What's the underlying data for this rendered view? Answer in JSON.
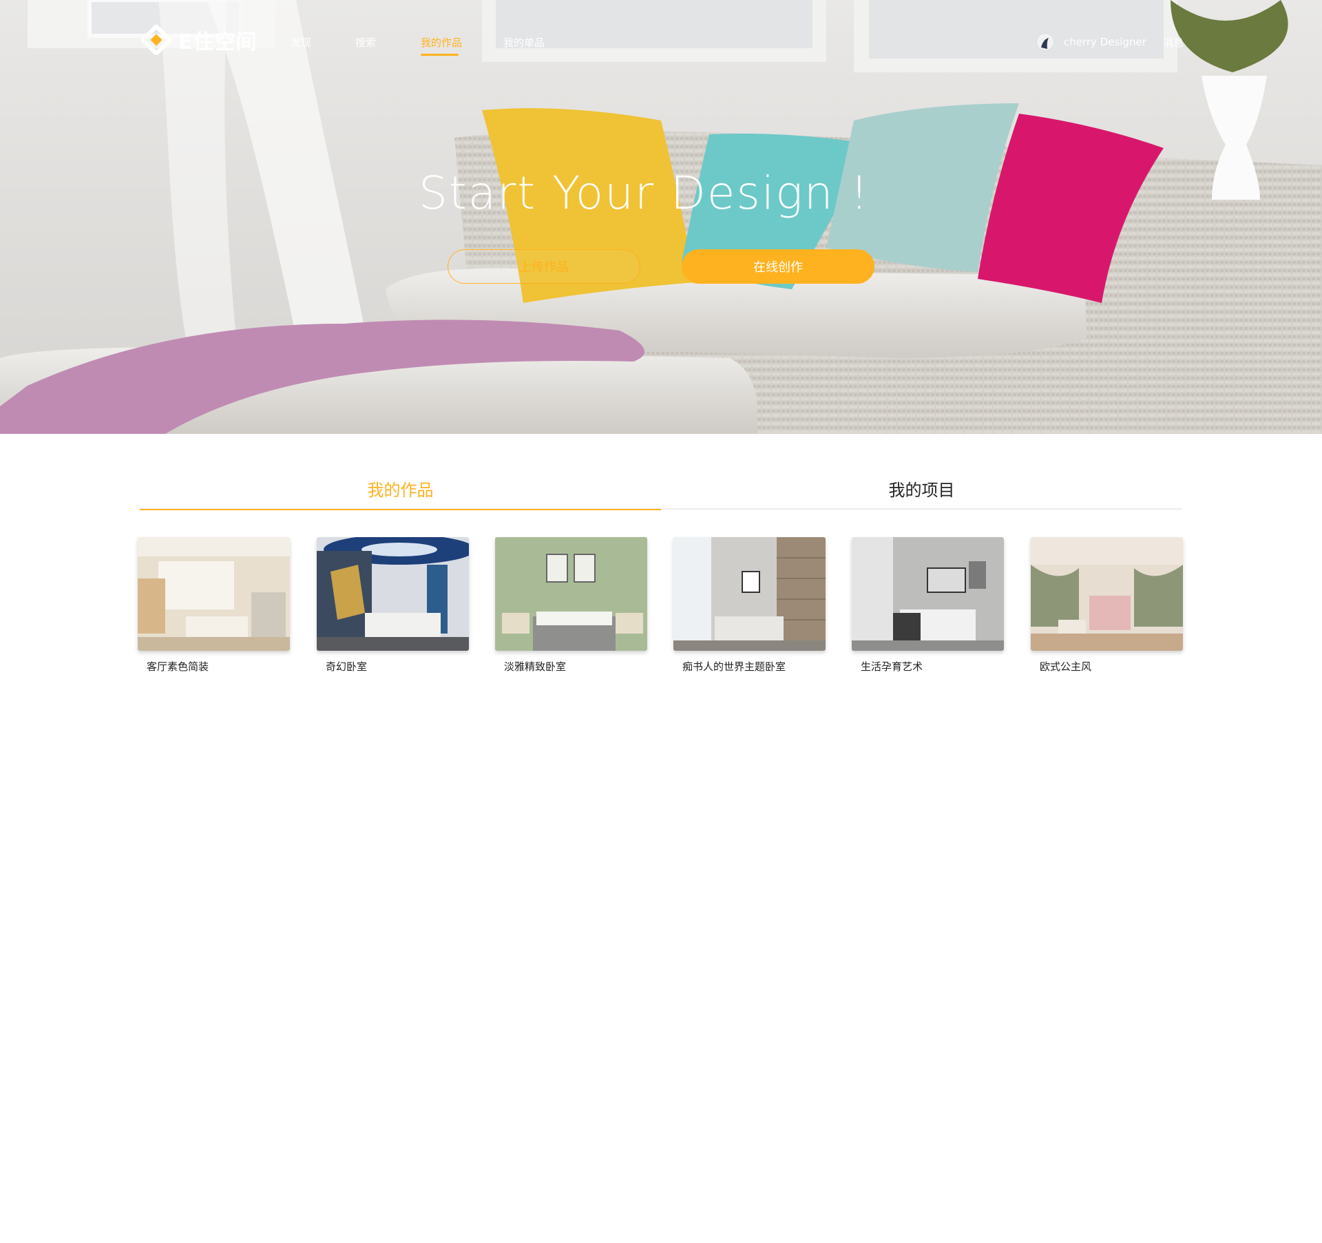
{
  "brand": {
    "name": "E住空间"
  },
  "nav": {
    "items": [
      {
        "label": "发现"
      },
      {
        "label": "搜索"
      },
      {
        "label": "我的作品"
      },
      {
        "label": "我的单品"
      }
    ],
    "active_index": 2,
    "user_name": "cherry Designer",
    "message_label": "消息"
  },
  "hero": {
    "title": "Start Your Design !",
    "upload_button": "上传作品",
    "create_button": "在线创作"
  },
  "tabs": [
    {
      "label": "我的作品",
      "active": true
    },
    {
      "label": "我的项目",
      "active": false
    }
  ],
  "works": [
    {
      "title": "客厅素色简装"
    },
    {
      "title": "奇幻卧室"
    },
    {
      "title": "淡雅精致卧室"
    },
    {
      "title": "痴书人的世界主题卧室"
    },
    {
      "title": "生活孕育艺术"
    },
    {
      "title": "欧式公主风"
    }
  ],
  "colors": {
    "accent": "#ffb21f",
    "text": "#222222",
    "divider": "#ececec"
  },
  "icons": {
    "logo": "diamond-logo-icon",
    "avatar": "user-avatar"
  }
}
